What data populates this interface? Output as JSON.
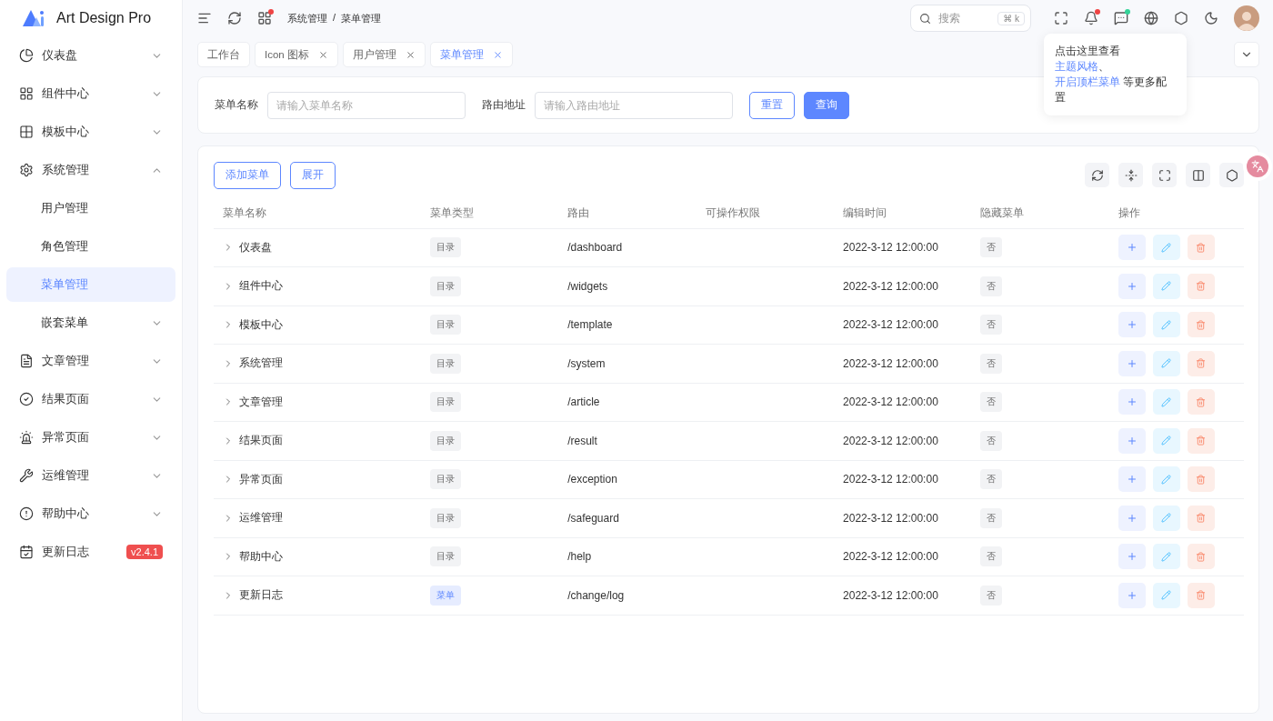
{
  "brand": {
    "name": "Art Design Pro"
  },
  "sidebar": {
    "items": [
      {
        "label": "仪表盘",
        "kind": "group",
        "expanded": false,
        "selected": false
      },
      {
        "label": "组件中心",
        "kind": "group",
        "expanded": false,
        "selected": false
      },
      {
        "label": "模板中心",
        "kind": "group",
        "expanded": false,
        "selected": false
      },
      {
        "label": "系统管理",
        "kind": "group",
        "expanded": true,
        "selected": false,
        "children": [
          {
            "label": "用户管理",
            "kind": "link",
            "selected": false
          },
          {
            "label": "角色管理",
            "kind": "link",
            "selected": false
          },
          {
            "label": "菜单管理",
            "kind": "link",
            "selected": true
          },
          {
            "label": "嵌套菜单",
            "kind": "group",
            "expanded": false,
            "selected": false
          }
        ]
      },
      {
        "label": "文章管理",
        "kind": "group",
        "expanded": false,
        "selected": false
      },
      {
        "label": "结果页面",
        "kind": "group",
        "expanded": false,
        "selected": false
      },
      {
        "label": "异常页面",
        "kind": "group",
        "expanded": false,
        "selected": false
      },
      {
        "label": "运维管理",
        "kind": "group",
        "expanded": false,
        "selected": false
      },
      {
        "label": "帮助中心",
        "kind": "group",
        "expanded": false,
        "selected": false
      },
      {
        "label": "更新日志",
        "kind": "link",
        "selected": false,
        "badge": "v2.4.1"
      }
    ]
  },
  "header": {
    "left_tools": [
      {
        "kind": "fold"
      },
      {
        "kind": "refresh"
      },
      {
        "kind": "apps",
        "color": "#ef4444"
      }
    ],
    "breadcrumb": [
      "系统管理",
      "菜单管理"
    ],
    "breadcrumb_separator": "/",
    "search": {
      "placeholder": "搜索",
      "shortcut": "⌘ k"
    },
    "right_tools": [
      {
        "kind": "fullscreen"
      },
      {
        "kind": "bell",
        "color": "#ef4444"
      },
      {
        "kind": "chat",
        "color": "#34d399"
      },
      {
        "kind": "globe"
      },
      {
        "kind": "settings"
      },
      {
        "kind": "moon"
      }
    ]
  },
  "tabs": [
    {
      "label": "工作台",
      "closable": false,
      "selected": false
    },
    {
      "label": "Icon 图标",
      "closable": true,
      "selected": false
    },
    {
      "label": "用户管理",
      "closable": true,
      "selected": false
    },
    {
      "label": "菜单管理",
      "closable": true,
      "selected": true
    }
  ],
  "tooltip": {
    "text": [
      "点击这里查看 ",
      "主题风格",
      "、 ",
      "开启顶栏菜单",
      " 等更多配置"
    ]
  },
  "filter": {
    "fields": [
      {
        "label": "菜单名称",
        "placeholder": "请输入菜单名称"
      },
      {
        "label": "路由地址",
        "placeholder": "请输入路由地址"
      }
    ],
    "reset": "重置",
    "submit": "查询"
  },
  "table": {
    "actions": [
      "添加菜单",
      "展开"
    ],
    "tools": [
      {
        "kind": "refresh"
      },
      {
        "kind": "density"
      },
      {
        "kind": "fullscreen"
      },
      {
        "kind": "columns"
      },
      {
        "kind": "settings"
      }
    ],
    "columns": [
      "菜单名称",
      "菜单类型",
      "路由",
      "可操作权限",
      "编辑时间",
      "隐藏菜单",
      "操作"
    ],
    "rows": [
      {
        "name": "仪表盘",
        "type": {
          "label": "目录",
          "color": "#f2f3f5"
        },
        "route": "/dashboard",
        "time": "2022-3-12 12:00:00",
        "hidden": "否"
      },
      {
        "name": "组件中心",
        "type": {
          "label": "目录",
          "color": "#f2f3f5"
        },
        "route": "/widgets",
        "time": "2022-3-12 12:00:00",
        "hidden": "否"
      },
      {
        "name": "模板中心",
        "type": {
          "label": "目录",
          "color": "#f2f3f5"
        },
        "route": "/template",
        "time": "2022-3-12 12:00:00",
        "hidden": "否"
      },
      {
        "name": "系统管理",
        "type": {
          "label": "目录",
          "color": "#f2f3f5"
        },
        "route": "/system",
        "time": "2022-3-12 12:00:00",
        "hidden": "否"
      },
      {
        "name": "文章管理",
        "type": {
          "label": "目录",
          "color": "#f2f3f5"
        },
        "route": "/article",
        "time": "2022-3-12 12:00:00",
        "hidden": "否"
      },
      {
        "name": "结果页面",
        "type": {
          "label": "目录",
          "color": "#f2f3f5"
        },
        "route": "/result",
        "time": "2022-3-12 12:00:00",
        "hidden": "否"
      },
      {
        "name": "异常页面",
        "type": {
          "label": "目录",
          "color": "#f2f3f5"
        },
        "route": "/exception",
        "time": "2022-3-12 12:00:00",
        "hidden": "否"
      },
      {
        "name": "运维管理",
        "type": {
          "label": "目录",
          "color": "#f2f3f5"
        },
        "route": "/safeguard",
        "time": "2022-3-12 12:00:00",
        "hidden": "否"
      },
      {
        "name": "帮助中心",
        "type": {
          "label": "目录",
          "color": "#f2f3f5"
        },
        "route": "/help",
        "time": "2022-3-12 12:00:00",
        "hidden": "否"
      },
      {
        "name": "更新日志",
        "type": {
          "label": "菜单",
          "color": "#e6ecff"
        },
        "route": "/change/log",
        "time": "2022-3-12 12:00:00",
        "hidden": "否"
      }
    ]
  }
}
